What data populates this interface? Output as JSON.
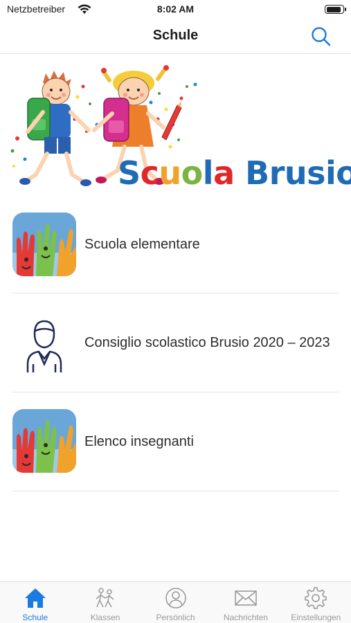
{
  "status_bar": {
    "carrier": "Netzbetreiber",
    "time": "8:02 AM",
    "battery_level": 0.9
  },
  "nav": {
    "title": "Schule",
    "search_icon": "search-icon"
  },
  "banner": {
    "logo_text": "Scuola Brusio",
    "letter_colors": [
      "#1f6bb5",
      "#e0282a",
      "#f0a22a",
      "#7ab542",
      "#1f6bb5",
      "#e0282a",
      "#1f6bb5",
      "#1f6bb5",
      "#1f6bb5",
      "#1f6bb5",
      "#1f6bb5",
      "#1f6bb5",
      "#1f6bb5"
    ]
  },
  "list": {
    "items": [
      {
        "label": "Scuola elementare",
        "icon": "painted-hands-image"
      },
      {
        "label": "Consiglio scolastico Brusio 2020 – 2023",
        "icon": "person-outline-icon"
      },
      {
        "label": "Elenco insegnanti",
        "icon": "painted-hands-image"
      }
    ]
  },
  "tab_bar": {
    "active": "Schule",
    "accent_color": "#1a7be0",
    "inactive_color": "#9a9a9e",
    "tabs": [
      {
        "label": "Schule",
        "icon": "home-icon"
      },
      {
        "label": "Klassen",
        "icon": "walking-kids-icon"
      },
      {
        "label": "Persönlich",
        "icon": "person-circle-icon"
      },
      {
        "label": "Nachrichten",
        "icon": "envelope-icon"
      },
      {
        "label": "Einstellungen",
        "icon": "gear-icon"
      }
    ]
  }
}
